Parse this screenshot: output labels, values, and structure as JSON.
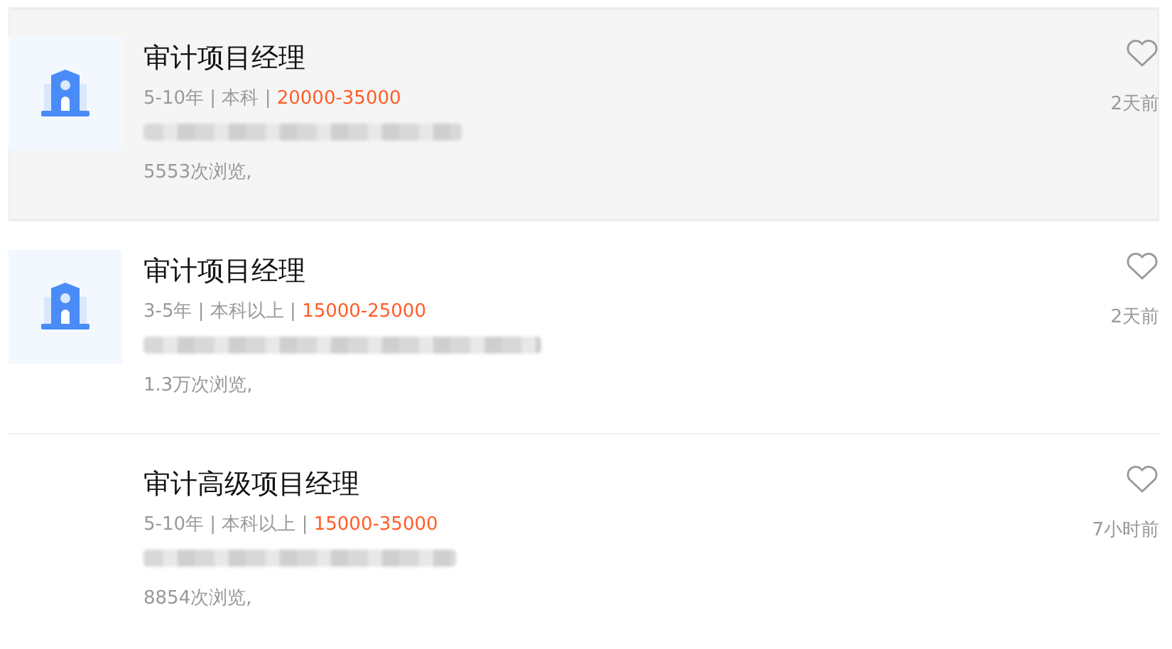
{
  "jobs": [
    {
      "title": "审计项目经理",
      "experience": "5-10年",
      "education": "本科",
      "salary": "20000-35000",
      "views": "5553次浏览,",
      "separator": "|",
      "posted": "2天前",
      "highlighted": true,
      "logo": true,
      "favorited": false
    },
    {
      "title": "审计项目经理",
      "experience": "3-5年",
      "education": "本科以上",
      "salary": "15000-25000",
      "views": "1.3万次浏览,",
      "separator": "|",
      "posted": "2天前",
      "highlighted": false,
      "logo": true,
      "favorited": false
    },
    {
      "title": "审计高级项目经理",
      "experience": "5-10年",
      "education": "本科以上",
      "salary": "15000-35000",
      "views": "8854次浏览,",
      "separator": "|",
      "posted": "7小时前",
      "highlighted": false,
      "logo": false,
      "favorited": false
    }
  ]
}
